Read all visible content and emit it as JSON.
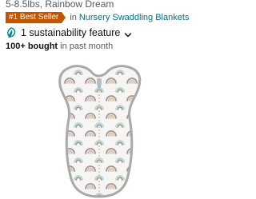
{
  "product": {
    "size_range": "5-8.5lbs, Rainbow Dream",
    "badge": "#1 Best Seller",
    "category_prefix": "in",
    "category": "Nursery Swaddling Blankets",
    "sustainability": "1 sustainability feature",
    "bought_count": "100+ bought",
    "bought_suffix": "in past month"
  },
  "colors": {
    "badge_bg": "#c45500",
    "link": "#007185",
    "leaf": "#008296",
    "rainbow_gray": "#9a9a9a",
    "rainbow_peach": "#e7b8a6",
    "rainbow_mint": "#bcd8cc"
  },
  "icons": {
    "leaf": "leaf-icon",
    "chevron": "chevron-down-icon"
  }
}
